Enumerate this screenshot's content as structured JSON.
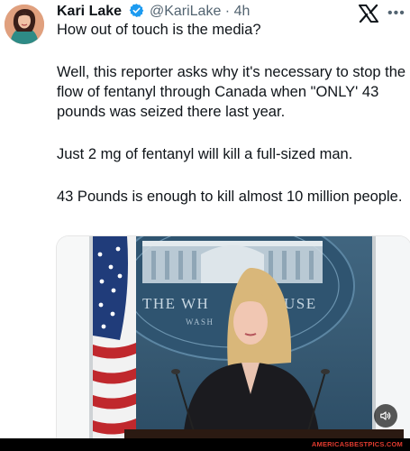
{
  "tweet": {
    "author_name": "Kari Lake",
    "handle": "@KariLake",
    "separator": "·",
    "time": "4h",
    "paragraphs": [
      "How out of touch is the media?",
      "Well, this reporter asks why it's necessary to stop the flow of fentanyl through Canada when \"ONLY' 43 pounds was seized there last year.",
      "Just 2 mg of fentanyl will kill a full-sized man.",
      "43 Pounds is enough to kill almost 10 million people."
    ]
  },
  "media": {
    "seal_text_top": "THE WH",
    "seal_text_top_right": "USE",
    "seal_text_bottom": "WASH"
  },
  "icons": {
    "verified": "verified-badge-icon",
    "logo": "x-logo-icon",
    "more": "more-options-icon",
    "sound": "speaker-icon"
  },
  "colors": {
    "verified_blue": "#1d9bf0",
    "watermark_red": "#e23b2f",
    "backdrop_blue": "#3a5f7a"
  },
  "footer": {
    "watermark": "AMERICASBESTPICS.COM"
  }
}
